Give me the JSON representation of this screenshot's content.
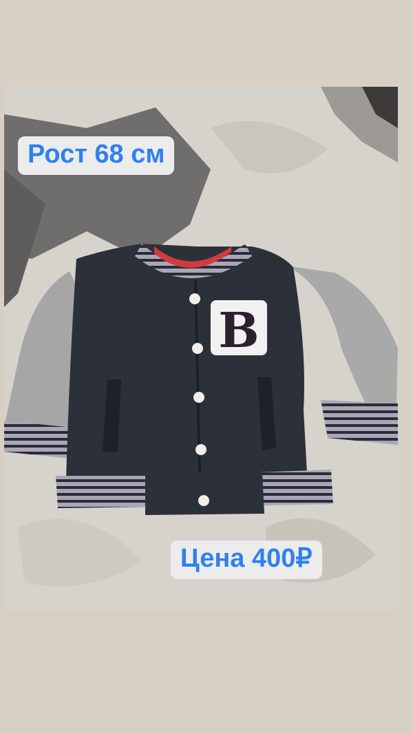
{
  "story": {
    "size_label": "Рост 68 см",
    "price_label": "Цена 400₽",
    "label_text_color": "#2f80ed",
    "label_background": "#ececec"
  },
  "photo": {
    "subject_icon": "varsity-jacket-icon",
    "patch_letter": "B"
  }
}
